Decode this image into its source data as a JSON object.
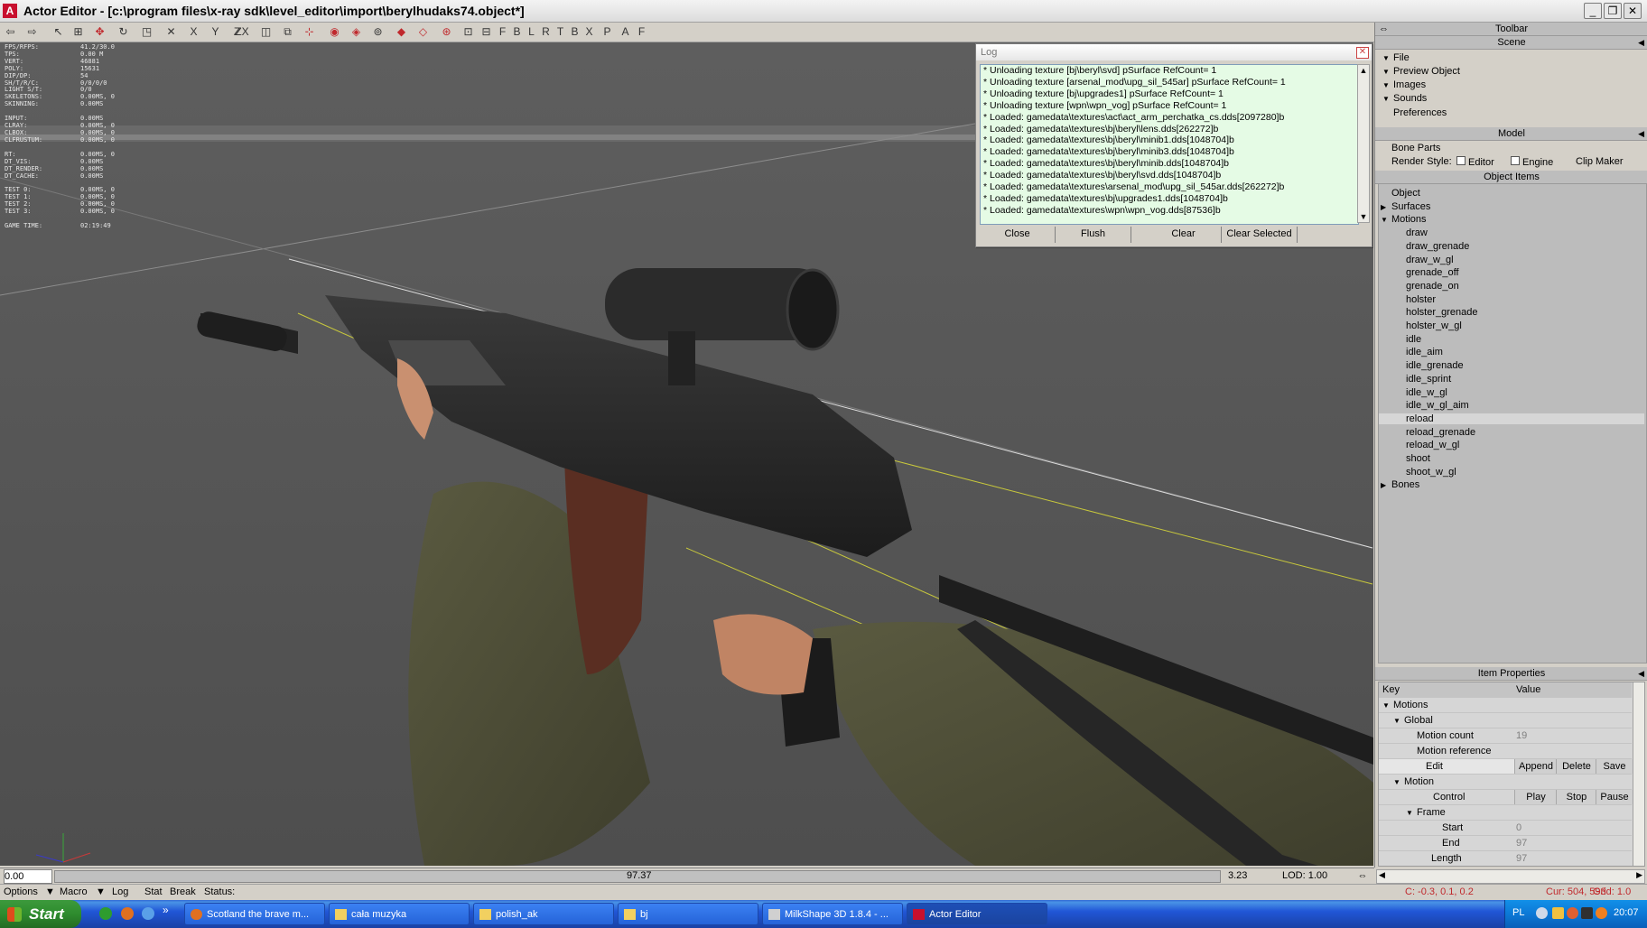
{
  "window": {
    "title": "Actor Editor - [c:\\program files\\x-ray sdk\\level_editor\\import\\berylhudaks74.object*]",
    "controls": [
      "_",
      "❐",
      "✕"
    ]
  },
  "toolbar": {
    "axis_labels": [
      "X",
      "Y",
      "Z",
      "ZX"
    ],
    "letter_buttons": [
      "F",
      "B",
      "L",
      "R",
      "T",
      "B",
      "X",
      "P",
      "A",
      "F"
    ]
  },
  "stats": [
    {
      "k": "FPS/RFPS:",
      "v": "41.2/30.0"
    },
    {
      "k": "TPS:",
      "v": "0.00 M"
    },
    {
      "k": "VERT:",
      "v": "46881"
    },
    {
      "k": "POLY:",
      "v": "15631"
    },
    {
      "k": "DIP/DP:",
      "v": "54"
    },
    {
      "k": "SH/T/R/C:",
      "v": "0/0/0/0"
    },
    {
      "k": "LIGHT S/T:",
      "v": "0/0"
    },
    {
      "k": "SKELETONS:",
      "v": "0.00MS, 0"
    },
    {
      "k": "SKINNING:",
      "v": "0.00MS"
    },
    {
      "k": "",
      "v": ""
    },
    {
      "k": "INPUT:",
      "v": "0.00MS"
    },
    {
      "k": "CLRAY:",
      "v": "0.00MS, 0"
    },
    {
      "k": "CLBOX:",
      "v": "0.00MS, 0"
    },
    {
      "k": "CLFRUSTUM:",
      "v": "0.00MS, 0"
    },
    {
      "k": "",
      "v": ""
    },
    {
      "k": "RT:",
      "v": "0.00MS, 0"
    },
    {
      "k": "DT_VIS:",
      "v": "0.00MS"
    },
    {
      "k": "DT_RENDER:",
      "v": "0.00MS"
    },
    {
      "k": "DT_CACHE:",
      "v": "0.00MS"
    },
    {
      "k": "",
      "v": ""
    },
    {
      "k": "TEST 0:",
      "v": "0.00MS, 0"
    },
    {
      "k": "TEST 1:",
      "v": "0.00MS, 0"
    },
    {
      "k": "TEST 2:",
      "v": "0.00MS, 0"
    },
    {
      "k": "TEST 3:",
      "v": "0.00MS, 0"
    },
    {
      "k": "",
      "v": ""
    },
    {
      "k": "GAME TIME:",
      "v": "02:19:49"
    }
  ],
  "log": {
    "title": "Log",
    "lines": [
      "* Unloading texture [bj\\beryl\\svd] pSurface RefCount= 1",
      "* Unloading texture [arsenal_mod\\upg_sil_545ar] pSurface RefCount= 1",
      "* Unloading texture [bj\\upgrades1] pSurface RefCount= 1",
      "* Unloading texture [wpn\\wpn_vog] pSurface RefCount= 1",
      "* Loaded: gamedata\\textures\\act\\act_arm_perchatka_cs.dds[2097280]b",
      "* Loaded: gamedata\\textures\\bj\\beryl\\lens.dds[262272]b",
      "* Loaded: gamedata\\textures\\bj\\beryl\\minib1.dds[1048704]b",
      "* Loaded: gamedata\\textures\\bj\\beryl\\minib3.dds[1048704]b",
      "* Loaded: gamedata\\textures\\bj\\beryl\\minib.dds[1048704]b",
      "* Loaded: gamedata\\textures\\bj\\beryl\\svd.dds[1048704]b",
      "* Loaded: gamedata\\textures\\arsenal_mod\\upg_sil_545ar.dds[262272]b",
      "* Loaded: gamedata\\textures\\bj\\upgrades1.dds[1048704]b",
      "* Loaded: gamedata\\textures\\wpn\\wpn_vog.dds[87536]b"
    ],
    "buttons": {
      "close": "Close",
      "flush": "Flush",
      "clear": "Clear",
      "clear_selected": "Clear Selected"
    }
  },
  "panel": {
    "toolbar_header": "Toolbar",
    "scene_header": "Scene",
    "scene_items": [
      "File",
      "Preview Object",
      "Images",
      "Sounds",
      "Preferences"
    ],
    "model_header": "Model",
    "bone_parts": "Bone Parts",
    "render_style_label": "Render Style:",
    "render_editor": "Editor",
    "render_engine": "Engine",
    "clip_maker": "Clip Maker",
    "object_items_header": "Object Items",
    "tree_top": [
      "Object",
      "Surfaces",
      "Motions"
    ],
    "motions": [
      "draw",
      "draw_grenade",
      "draw_w_gl",
      "grenade_off",
      "grenade_on",
      "holster",
      "holster_grenade",
      "holster_w_gl",
      "idle",
      "idle_aim",
      "idle_grenade",
      "idle_sprint",
      "idle_w_gl",
      "idle_w_gl_aim",
      "reload",
      "reload_grenade",
      "reload_w_gl",
      "shoot",
      "shoot_w_gl"
    ],
    "selected_motion": "reload",
    "bones": "Bones",
    "item_properties_header": "Item Properties",
    "props": {
      "key_header": "Key",
      "value_header": "Value",
      "motions": "Motions",
      "global": "Global",
      "motion_count": "Motion count",
      "motion_count_val": "19",
      "motion_reference": "Motion reference",
      "edit": "Edit",
      "append": "Append",
      "delete": "Delete",
      "save": "Save",
      "motion": "Motion",
      "control": "Control",
      "play": "Play",
      "stop": "Stop",
      "pause": "Pause",
      "frame": "Frame",
      "start": "Start",
      "start_val": "0",
      "end": "End",
      "end_val": "97",
      "length": "Length",
      "length_val": "97"
    }
  },
  "timeline": {
    "left": "0.00",
    "center": "97.37",
    "right": "3.23",
    "lod": "LOD: 1.00"
  },
  "statusbar": {
    "options": "Options",
    "macro": "Macro",
    "log": "Log",
    "stat": "Stat",
    "break": "Break",
    "status": "Status:",
    "coords": "C: -0.3, 0.1, 0.2",
    "cursor": "Cur: 504, 593",
    "grid": "Grid: 1.0"
  },
  "taskbar": {
    "start": "Start",
    "tasks": [
      "Scotland the brave m...",
      "cała muzyka",
      "polish_ak",
      "bj",
      "MilkShape 3D 1.8.4 - ...",
      "Actor Editor"
    ],
    "lang": "PL",
    "clock": "20:07"
  },
  "colors": {
    "viewport": "#535353",
    "log_bg": "#e5fbe5",
    "taskbar": "#245edb",
    "start": "#3c9a3c",
    "accent_red": "#c8102e"
  }
}
